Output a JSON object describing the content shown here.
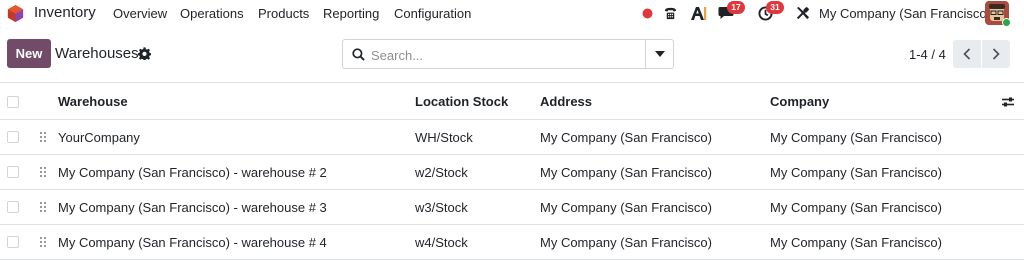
{
  "navbar": {
    "app_name": "Inventory",
    "menu": [
      "Overview",
      "Operations",
      "Products",
      "Reporting",
      "Configuration"
    ],
    "messages_badge": "17",
    "activities_badge": "31",
    "company": "My Company (San Francisco)",
    "brand_color": "#714b67",
    "badge_color": "#e0373f",
    "status_dot_color": "#e0373f",
    "icons": [
      "record-dot-icon",
      "phone-icon",
      "ai-icon",
      "chat-icon",
      "clock-icon",
      "tools-icon"
    ]
  },
  "control_panel": {
    "new_label": "New",
    "title": "Warehouses",
    "search_placeholder": "Search...",
    "pager": "1-4 / 4"
  },
  "table": {
    "columns": [
      "Warehouse",
      "Location Stock",
      "Address",
      "Company"
    ],
    "rows": [
      {
        "warehouse": "YourCompany",
        "stock": "WH/Stock",
        "address": "My Company (San Francisco)",
        "company": "My Company (San Francisco)"
      },
      {
        "warehouse": "My Company (San Francisco) - warehouse # 2",
        "stock": "w2/Stock",
        "address": "My Company (San Francisco)",
        "company": "My Company (San Francisco)"
      },
      {
        "warehouse": "My Company (San Francisco) - warehouse # 3",
        "stock": "w3/Stock",
        "address": "My Company (San Francisco)",
        "company": "My Company (San Francisco)"
      },
      {
        "warehouse": "My Company (San Francisco) - warehouse # 4",
        "stock": "w4/Stock",
        "address": "My Company (San Francisco)",
        "company": "My Company (San Francisco)"
      }
    ]
  }
}
